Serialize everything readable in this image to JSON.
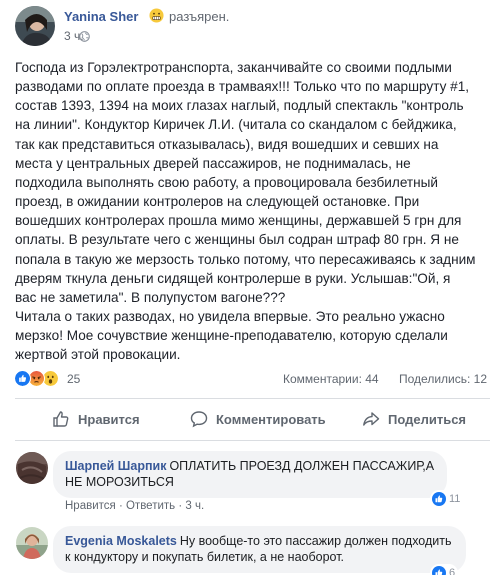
{
  "post": {
    "author": "Yanina Sher",
    "feeling_icon": "grimace-emoji-icon",
    "feeling": "разъярен.",
    "time": "3 ч.",
    "text": "Господа из Горэлектротранспорта, заканчивайте со своими подлыми\nразводами по оплате проезда в трамваях!!! Только что по маршруту #1,\nсостав 1393, 1394 на моих глазах наглый, подлый спектакль \"контроль\nна линии\". Кондуктор Киричек Л.И. (читала со скандалом с бейджика,\nтак как представиться отказывалась), видя вошедших и севших на\nместа у центральных дверей пассажиров, не поднималась, не\nподходила выполнять свою работу, а провоцировала безбилетный\nпроезд, в ожидании контролеров на следующей остановке. При\nвошедших контролерах прошла мимо женщины, державшей 5 грн для\nоплаты. В результате чего с женщины был содран штраф 80 грн. Я не\nпопала в такую же мерзость только потому, что пересаживаясь к задним\nдверям ткнула деньги сидящей контролерше в руки. Услышав:\"Ой, я\nвас не заметила\". В полупустом вагоне???\nЧитала о таких разводах, но увидела впервые. Это реально ужасно\nмерзко! Мое сочувствие женщине-преподавателю, которую сделали\nжертвой этой провокации."
  },
  "summary": {
    "reactions": [
      "like",
      "angry",
      "wow"
    ],
    "reaction_count": "25",
    "comments": "Комментарии: 44",
    "shares": "Поделились: 12"
  },
  "actions": {
    "like": "Нравится",
    "comment": "Комментировать",
    "share": "Поделиться"
  },
  "comments": [
    {
      "author": "Шарпей Шарпик",
      "text": "ОПЛАТИТЬ ПРОЕЗД ДОЛЖЕН ПАССАЖИР,А НЕ МОРОЗИТЬСЯ",
      "like_label": "Нравится",
      "reply_label": "Ответить",
      "time": "3 ч.",
      "likes": "11"
    },
    {
      "author": "Evgenia Moskalets",
      "text": "Ну вообще-то это пассажир должен подходить к кондуктору и покупать билетик, а не наоборот.",
      "likes": "6"
    }
  ],
  "colors": {
    "link": "#385898",
    "like_blue": "#1877f2",
    "angry_orange": "#f0622c",
    "wow_yellow": "#f7c93b",
    "comment_bg": "#f2f3f5"
  }
}
